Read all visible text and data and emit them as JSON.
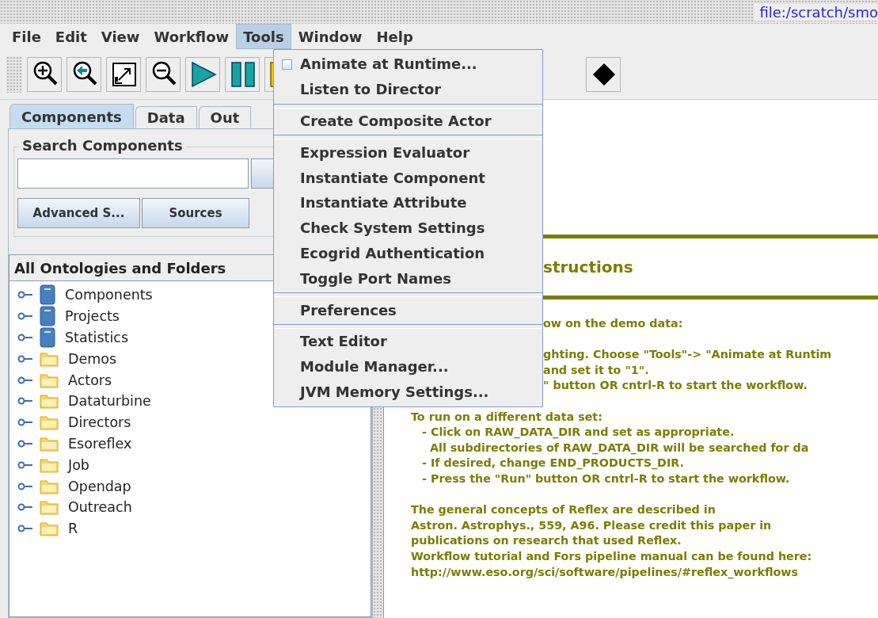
{
  "title_bar": {
    "path": "file:/scratch/smo"
  },
  "menu_bar": [
    {
      "label": "File",
      "selected": false
    },
    {
      "label": "Edit",
      "selected": false
    },
    {
      "label": "View",
      "selected": false
    },
    {
      "label": "Workflow",
      "selected": false
    },
    {
      "label": "Tools",
      "selected": true
    },
    {
      "label": "Window",
      "selected": false
    },
    {
      "label": "Help",
      "selected": false
    }
  ],
  "toolbar": {
    "left": [
      {
        "kind": "zoom-in"
      },
      {
        "kind": "zoom-reset"
      },
      {
        "kind": "zoom-fit"
      },
      {
        "kind": "zoom-out"
      },
      {
        "kind": "run"
      },
      {
        "kind": "pause"
      },
      {
        "kind": "stop"
      }
    ],
    "right": [
      {
        "kind": "diamond"
      }
    ]
  },
  "tabs": [
    {
      "label": "Components",
      "selected": true
    },
    {
      "label": "Data",
      "selected": false
    },
    {
      "label": "Out",
      "selected": false
    }
  ],
  "search": {
    "title": "Search Components",
    "buttons": [
      "Advanced S...",
      "Sources"
    ]
  },
  "tree": {
    "header": "All Ontologies and Folders",
    "items": [
      {
        "label": "Components",
        "kind": "library"
      },
      {
        "label": "Projects",
        "kind": "library"
      },
      {
        "label": "Statistics",
        "kind": "library"
      },
      {
        "label": "Demos",
        "kind": "folder"
      },
      {
        "label": "Actors",
        "kind": "folder"
      },
      {
        "label": "Dataturbine",
        "kind": "folder"
      },
      {
        "label": "Directors",
        "kind": "folder"
      },
      {
        "label": "Esoreflex",
        "kind": "folder"
      },
      {
        "label": "Job",
        "kind": "folder"
      },
      {
        "label": "Opendap",
        "kind": "folder"
      },
      {
        "label": "Outreach",
        "kind": "folder"
      },
      {
        "label": "R",
        "kind": "folder"
      }
    ]
  },
  "document": {
    "heading": "structions",
    "lines": [
      {
        "text": "ow on the demo data:",
        "kind": "partial"
      },
      {
        "kind": "blank"
      },
      {
        "text": "ghting. Choose \"Tools\"-> \"Animate at Runtim",
        "kind": "partial"
      },
      {
        "text": "and set it to \"1\".",
        "kind": "partial"
      },
      {
        "text": "\" button OR cntrl-R to start the workflow.",
        "kind": "partial"
      },
      {
        "kind": "blank"
      },
      {
        "text": "To run on a different data set:",
        "kind": "line"
      },
      {
        "text": "- Click on RAW_DATA_DIR and set as appropriate.",
        "kind": "bullet"
      },
      {
        "text": "All subdirectories of RAW_DATA_DIR will be searched for da",
        "kind": "continuation"
      },
      {
        "text": "- If desired, change END_PRODUCTS_DIR.",
        "kind": "bullet"
      },
      {
        "text": "- Press the \"Run\" button OR cntrl-R to start the workflow.",
        "kind": "bullet"
      },
      {
        "kind": "blank"
      },
      {
        "text": "The general concepts of Reflex are described in",
        "kind": "line"
      },
      {
        "text": "Astron. Astrophys., 559, A96. Please credit this paper in",
        "kind": "line"
      },
      {
        "text": "publications on research that used Reflex.",
        "kind": "line"
      },
      {
        "text": "Workflow tutorial and Fors pipeline manual can be found here:",
        "kind": "line"
      },
      {
        "text": "http://www.eso.org/sci/software/pipelines/#reflex_workflows",
        "kind": "line"
      }
    ]
  },
  "tools_menu": [
    {
      "kind": "checkbox",
      "label": "Animate at Runtime...",
      "checked": false
    },
    {
      "kind": "item",
      "label": "Listen to Director"
    },
    {
      "kind": "separator"
    },
    {
      "kind": "item",
      "label": "Create Composite Actor"
    },
    {
      "kind": "separator"
    },
    {
      "kind": "item",
      "label": "Expression Evaluator"
    },
    {
      "kind": "item",
      "label": "Instantiate Component"
    },
    {
      "kind": "item",
      "label": "Instantiate Attribute"
    },
    {
      "kind": "item",
      "label": "Check System Settings"
    },
    {
      "kind": "item",
      "label": "Ecogrid Authentication"
    },
    {
      "kind": "item",
      "label": "Toggle Port Names"
    },
    {
      "kind": "separator"
    },
    {
      "kind": "item",
      "label": "Preferences"
    },
    {
      "kind": "separator"
    },
    {
      "kind": "item",
      "label": "Text Editor"
    },
    {
      "kind": "item",
      "label": "Module Manager..."
    },
    {
      "kind": "item",
      "label": "JVM Memory Settings..."
    }
  ]
}
